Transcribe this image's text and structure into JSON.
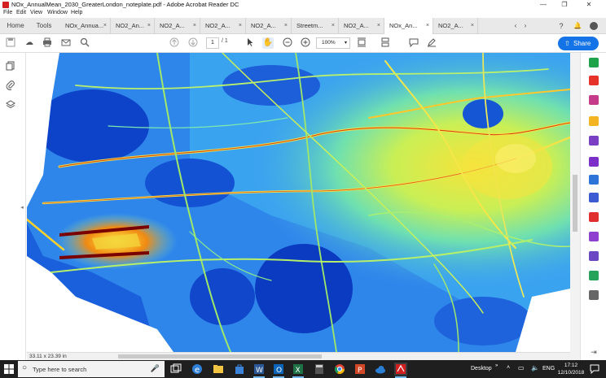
{
  "window": {
    "title": "NOx_AnnualMean_2030_GreaterLondon_noteplate.pdf - Adobe Acrobat Reader DC",
    "minimize": "—",
    "maximize": "❐",
    "close": "✕"
  },
  "menu": [
    "File",
    "Edit",
    "View",
    "Window",
    "Help"
  ],
  "nav_tabs": {
    "home": "Home",
    "tools": "Tools"
  },
  "doc_tabs": [
    {
      "label": "NOx_Annua..."
    },
    {
      "label": "NO2_An..."
    },
    {
      "label": "NO2_A..."
    },
    {
      "label": "NO2_A..."
    },
    {
      "label": "NO2_A..."
    },
    {
      "label": "Streetm..."
    },
    {
      "label": "NO2_A..."
    },
    {
      "label": "NOx_An...",
      "active": true
    },
    {
      "label": "NO2_A..."
    }
  ],
  "toolbar": {
    "page_current": "1",
    "page_total": "/ 1",
    "zoom": "100%",
    "share_label": "Share"
  },
  "status": {
    "page_size": "33.11 x 23.39 in"
  },
  "taskbar": {
    "search_placeholder": "Type here to search",
    "desktop_label": "Desktop",
    "language": "ENG",
    "time": "17:12",
    "date": "12/10/2018"
  },
  "colors": {
    "accent": "#1473e6",
    "map_low": "#0d43c9",
    "map_mid": "#47b5f5",
    "map_high": "#ffd21e",
    "map_peak": "#8b0000"
  }
}
